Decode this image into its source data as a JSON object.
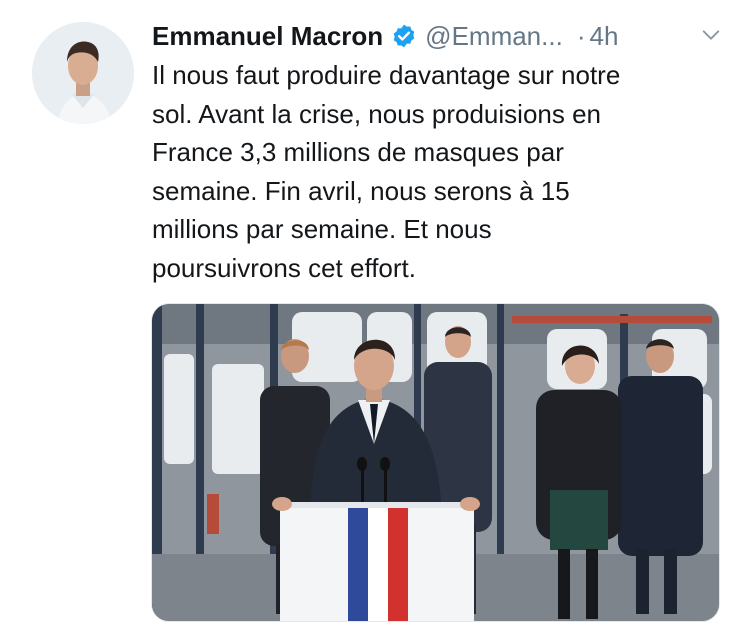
{
  "tweet": {
    "author_name": "Emmanuel Macron",
    "handle": "@Emman...",
    "separator": "·",
    "time": "4h",
    "text_lines": [
      "Il nous faut produire davantage sur notre",
      "sol. Avant la crise, nous produisions en",
      "France 3,3 millions de masques par",
      "semaine. Fin avril, nous serons à 15",
      "millions par semaine. Et nous",
      "poursuivrons cet effort."
    ]
  },
  "icons": {
    "verified": "verified-badge-icon",
    "menu": "chevron-down-icon"
  },
  "colors": {
    "verified_blue": "#1da1f2",
    "secondary_text": "#657786",
    "primary_text": "#14171a"
  }
}
